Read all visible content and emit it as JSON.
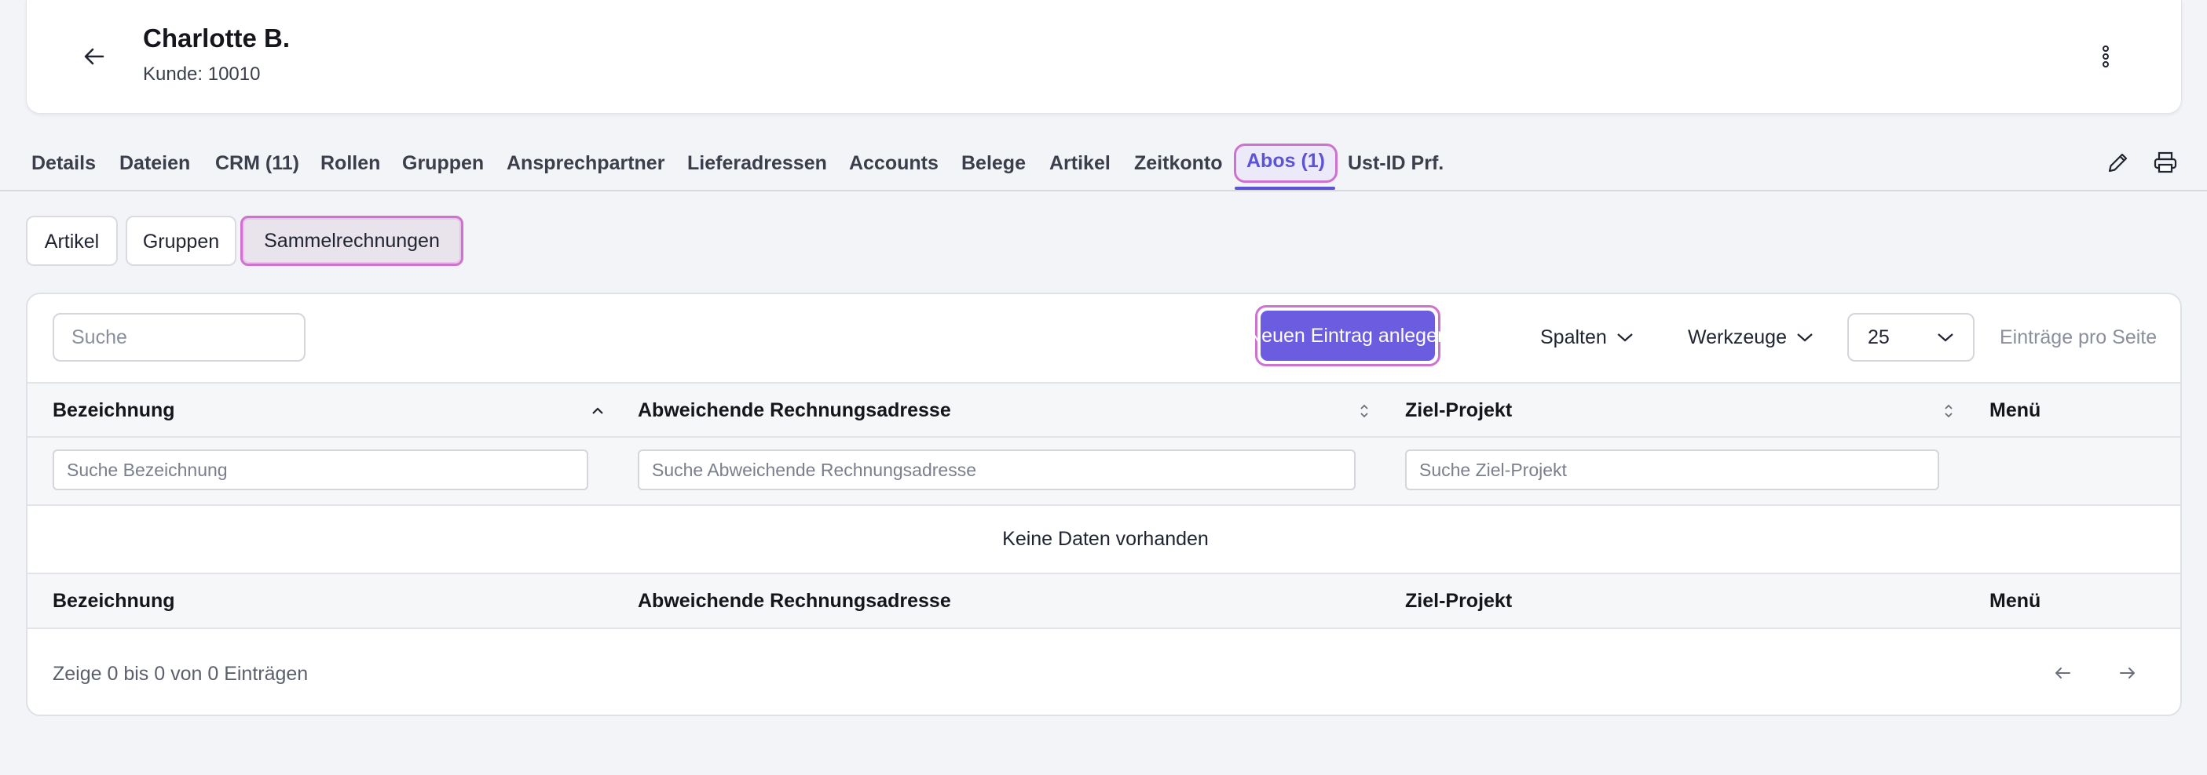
{
  "header": {
    "name": "Charlotte B.",
    "subtitle": "Kunde: 10010"
  },
  "tabs": [
    {
      "label": "Details"
    },
    {
      "label": "Dateien"
    },
    {
      "label": "CRM (11)"
    },
    {
      "label": "Rollen"
    },
    {
      "label": "Gruppen"
    },
    {
      "label": "Ansprechpartner"
    },
    {
      "label": "Lieferadressen"
    },
    {
      "label": "Accounts"
    },
    {
      "label": "Belege"
    },
    {
      "label": "Artikel"
    },
    {
      "label": "Zeitkonto"
    },
    {
      "label": "Abos (1)",
      "active": true
    },
    {
      "label": "Ust-ID Prf."
    }
  ],
  "subtabs": [
    {
      "label": "Artikel"
    },
    {
      "label": "Gruppen"
    },
    {
      "label": "Sammelrechnungen",
      "active": true
    }
  ],
  "toolbar": {
    "search_placeholder": "Suche",
    "new_entry_label": "Neuen Eintrag anlegen",
    "columns_label": "Spalten",
    "tools_label": "Werkzeuge",
    "page_size": "25",
    "per_page_label": "Einträge pro Seite"
  },
  "table": {
    "columns": [
      "Bezeichnung",
      "Abweichende Rechnungsadresse",
      "Ziel-Projekt",
      "Menü"
    ],
    "filter_placeholders": [
      "Suche Bezeichnung",
      "Suche Abweichende Rechnungsadresse",
      "Suche Ziel-Projekt"
    ],
    "empty_message": "Keine Daten vorhanden",
    "info": "Zeige 0 bis 0 von 0 Einträgen"
  },
  "colors": {
    "accent": "#5b54d6",
    "button": "#6b5ce0",
    "highlight_border": "#cf72cf"
  }
}
